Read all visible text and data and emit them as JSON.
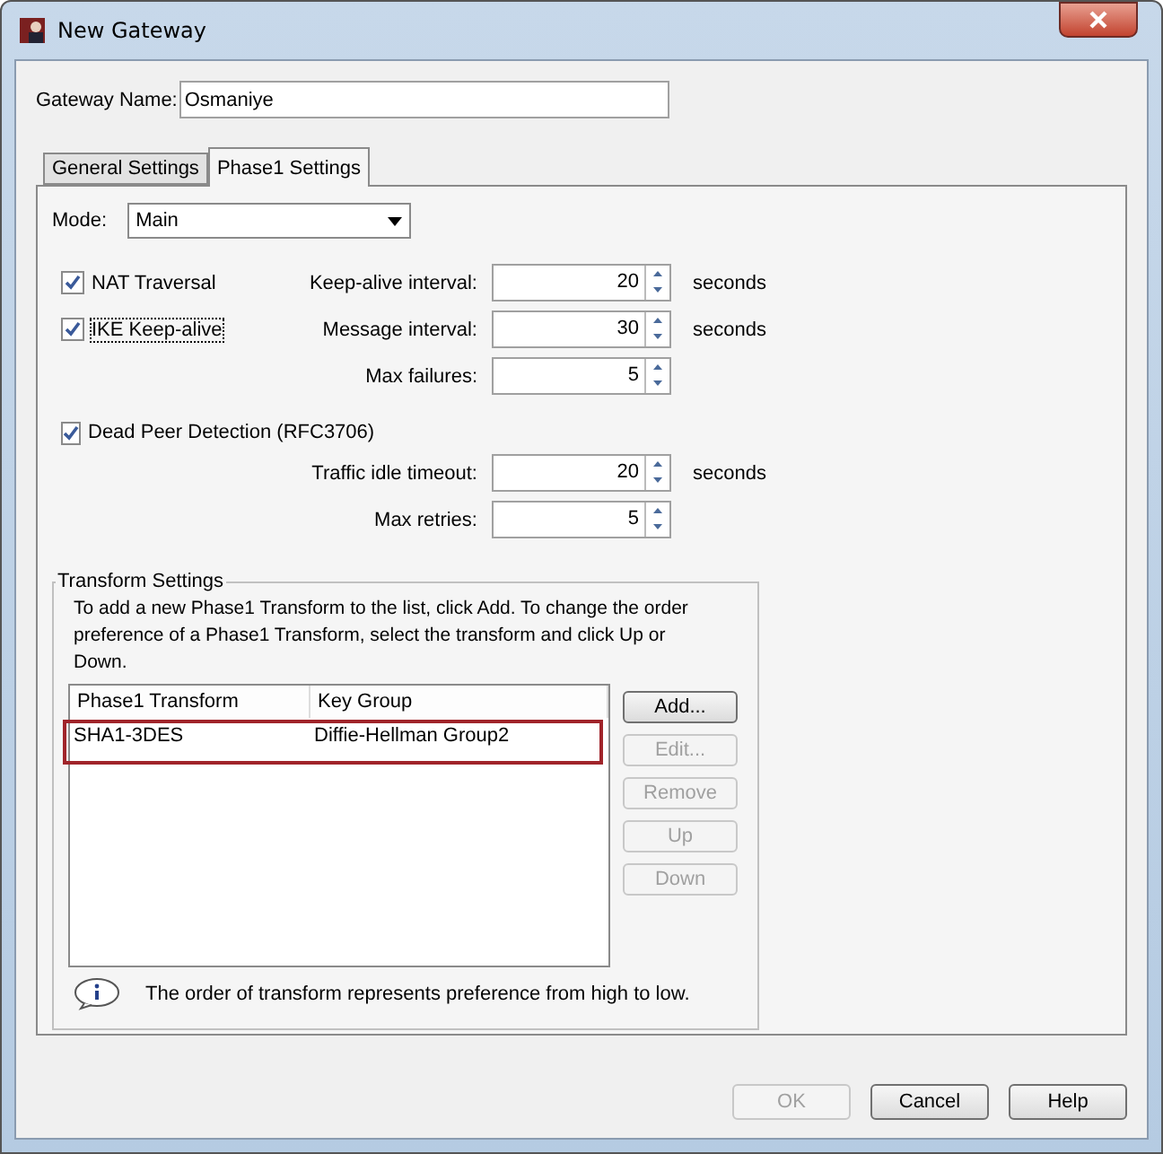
{
  "window": {
    "title": "New Gateway"
  },
  "gateway_name": {
    "label": "Gateway Name:",
    "value": "Osmaniye"
  },
  "tabs": [
    {
      "label": "General Settings",
      "selected": false
    },
    {
      "label": "Phase1 Settings",
      "selected": true
    }
  ],
  "mode": {
    "label": "Mode:",
    "value": "Main"
  },
  "sections": [
    {
      "rows": [
        {
          "checkbox": {
            "label": "NAT Traversal",
            "checked": true,
            "focused": false
          },
          "field": {
            "label": "Keep-alive interval:",
            "value": "20",
            "unit": "seconds"
          }
        },
        {
          "checkbox": {
            "label": "IKE Keep-alive",
            "checked": true,
            "focused": true
          },
          "field": {
            "label": "Message interval:",
            "value": "30",
            "unit": "seconds"
          }
        },
        {
          "field": {
            "label": "Max failures:",
            "value": "5"
          }
        }
      ]
    },
    {
      "rows": [
        {
          "checkbox": {
            "label": "Dead Peer Detection (RFC3706)",
            "checked": true,
            "focused": false
          }
        },
        {
          "field": {
            "label": "Traffic idle timeout:",
            "value": "20",
            "unit": "seconds"
          }
        },
        {
          "field": {
            "label": "Max retries:",
            "value": "5"
          }
        }
      ]
    }
  ],
  "transform_settings": {
    "legend": "Transform Settings",
    "description": "To add a new Phase1 Transform to the list, click Add. To change the order preference of a Phase1 Transform, select the transform and click Up or Down.",
    "columns": [
      "Phase1 Transform",
      "Key Group"
    ],
    "rows": [
      {
        "cells": [
          "SHA1-3DES",
          "Diffie-Hellman Group2"
        ],
        "highlighted": true
      }
    ],
    "buttons": [
      {
        "label": "Add...",
        "disabled": false
      },
      {
        "label": "Edit...",
        "disabled": true
      },
      {
        "label": "Remove",
        "disabled": true
      },
      {
        "label": "Up",
        "disabled": true
      },
      {
        "label": "Down",
        "disabled": true
      }
    ],
    "note": "The order of transform represents preference from high to low."
  },
  "footer_buttons": [
    {
      "label": "OK",
      "disabled": true
    },
    {
      "label": "Cancel",
      "disabled": false
    },
    {
      "label": "Help",
      "disabled": false
    }
  ]
}
